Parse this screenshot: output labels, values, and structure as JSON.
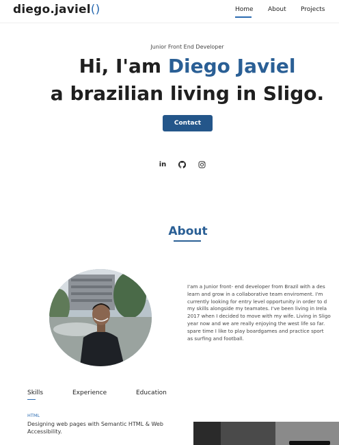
{
  "header": {
    "logo_text": "diego.javiel",
    "logo_brace": "()",
    "nav": {
      "home": "Home",
      "about": "About",
      "projects": "Projects"
    },
    "accent": "#2a6ab0"
  },
  "hero": {
    "subtitle": "Junior Front End Developer",
    "greeting": "Hi, I'am ",
    "name": "Diego Javiel",
    "tagline": "a brazilian living in Sligo.",
    "contact_label": "Contact",
    "socials": [
      "linkedin-icon",
      "github-icon",
      "instagram-icon"
    ],
    "linkedin_text": "in"
  },
  "about": {
    "title": "About",
    "paragraph_lines": [
      "I'am a Junior front- end developer from Brazil with a des",
      "learn and grow in a collaborative team enviroment. I'm",
      "currently looking for entry level opportunity in order to d",
      "my skills alongside my teamates. I've been living in Irela",
      "2017 when I decided to move with my wife. Living in Sligo",
      "year now and we are really enjoying the west life so far.",
      "spare time I like to play boardgames and practice sport",
      "as surfing and football."
    ]
  },
  "tabs": {
    "skills": "Skills",
    "experience": "Experience",
    "education": "Education"
  },
  "skills": {
    "label": "HTML",
    "description": "Designing web pages with Semantic HTML & Web Accessibility."
  }
}
